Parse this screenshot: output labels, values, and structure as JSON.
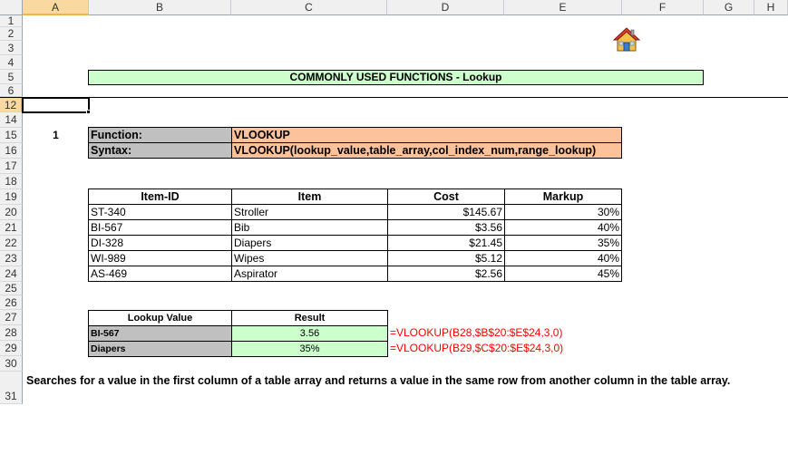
{
  "columns": [
    "A",
    "B",
    "C",
    "D",
    "E",
    "F",
    "G",
    "H"
  ],
  "rows": [
    "1",
    "2",
    "3",
    "4",
    "5",
    "6",
    "12",
    "14",
    "15",
    "16",
    "17",
    "18",
    "19",
    "20",
    "21",
    "22",
    "23",
    "24",
    "25",
    "26",
    "27",
    "28",
    "29",
    "30",
    "31"
  ],
  "home_icon": "house-icon",
  "title": "COMMONLY USED FUNCTIONS - Lookup",
  "example_number": "1",
  "function_label": "Function:",
  "function_name": "VLOOKUP",
  "syntax_label": "Syntax:",
  "syntax_value": "VLOOKUP(lookup_value,table_array,col_index_num,range_lookup)",
  "table": {
    "headers": [
      "Item-ID",
      "Item",
      "Cost",
      "Markup"
    ],
    "rows": [
      [
        "ST-340",
        "Stroller",
        "$145.67",
        "30%"
      ],
      [
        "BI-567",
        "Bib",
        "$3.56",
        "40%"
      ],
      [
        "DI-328",
        "Diapers",
        "$21.45",
        "35%"
      ],
      [
        "WI-989",
        "Wipes",
        "$5.12",
        "40%"
      ],
      [
        "AS-469",
        "Aspirator",
        "$2.56",
        "45%"
      ]
    ]
  },
  "lookup": {
    "headers": [
      "Lookup Value",
      "Result"
    ],
    "rows": [
      {
        "key": "BI-567",
        "result": "3.56",
        "formula": "=VLOOKUP(B28,$B$20:$E$24,3,0)"
      },
      {
        "key": "Diapers",
        "result": "35%",
        "formula": "=VLOOKUP(B29,$C$20:$E$24,3,0)"
      }
    ]
  },
  "description": "Searches for a value in the first column of a table array and returns a value in the same row from another column in the table array.",
  "colors": {
    "title_fill": "#ccffcc",
    "label_fill": "#c0c0c0",
    "value_fill": "#fcc29c",
    "result_fill": "#ccffcc",
    "formula_text": "#ff0000",
    "selection_header": "#f9d99f"
  }
}
